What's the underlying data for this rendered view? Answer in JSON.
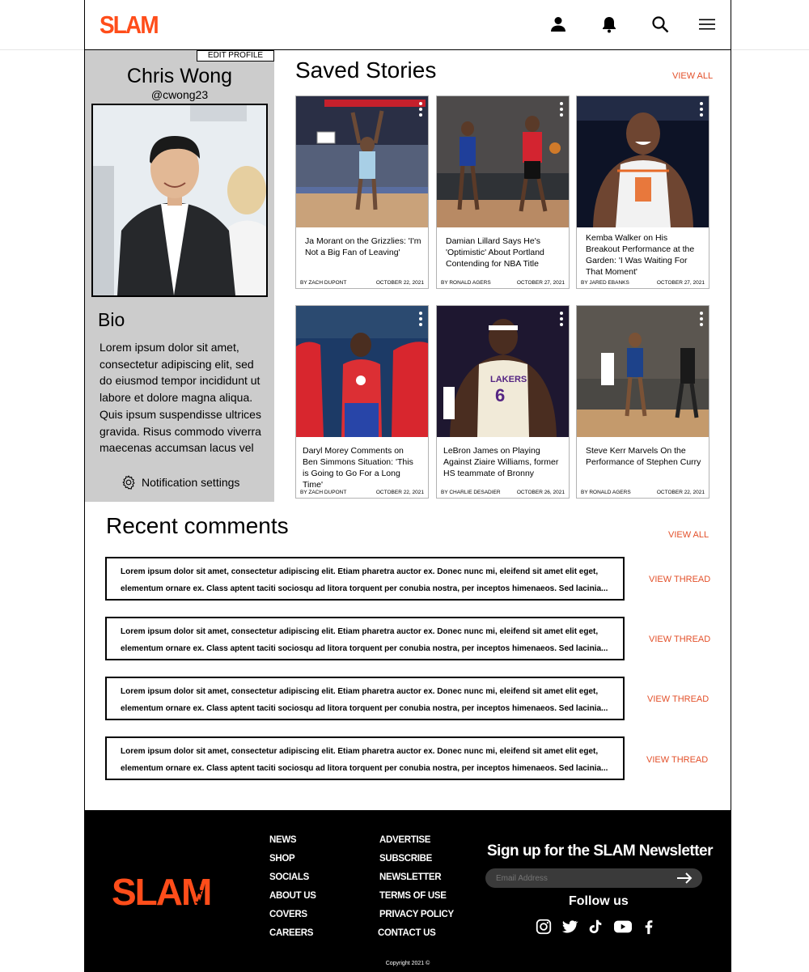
{
  "header": {
    "logo": "SLAM"
  },
  "profile": {
    "edit_label": "EDIT PROFILE",
    "name": "Chris Wong",
    "handle": "@cwong23",
    "bio_heading": "Bio",
    "bio_text": "Lorem ipsum dolor sit amet, consectetur adipiscing elit, sed do eiusmod tempor incididunt ut labore et dolore magna aliqua. Quis ipsum suspendisse ultrices gravida. Risus commodo viverra maecenas accumsan lacus vel",
    "notification_label": "Notification settings"
  },
  "saved": {
    "heading": "Saved Stories",
    "view_all": "VIEW ALL",
    "stories": [
      {
        "title": "Ja Morant on the Grizzlies: 'I'm Not a Big Fan of Leaving'",
        "author": "BY ZACH DUPONT",
        "date": "OCTOBER 22, 2021"
      },
      {
        "title": "Damian Lillard Says He's 'Optimistic' About Portland Contending for NBA Title",
        "author": "BY RONALD AGERS",
        "date": "OCTOBER 27, 2021"
      },
      {
        "title": "Kemba Walker on His Breakout Performance at the Garden: 'I Was Waiting For That Moment'",
        "author": "BY JARED EBANKS",
        "date": "OCTOBER 27, 2021"
      },
      {
        "title": "Daryl Morey Comments on Ben Simmons Situation: 'This is Going to Go For a Long Time'",
        "author": "BY ZACH DUPONT",
        "date": "OCTOBER 22, 2021"
      },
      {
        "title": "LeBron James on Playing Against Ziaire Williams, former HS teammate of Bronny",
        "author": "BY CHARLIE DESADIER",
        "date": "OCTOBER 26, 2021"
      },
      {
        "title": "Steve Kerr Marvels On the Performance of Stephen Curry",
        "author": "BY RONALD AGERS",
        "date": "OCTOBER 22, 2021"
      }
    ]
  },
  "comments": {
    "heading": "Recent comments",
    "view_all": "VIEW ALL",
    "items": [
      {
        "text": "Lorem ipsum dolor sit amet, consectetur adipiscing elit. Etiam pharetra auctor ex. Donec nunc mi, eleifend sit amet elit eget, elementum ornare ex. Class aptent taciti sociosqu ad litora torquent per conubia nostra, per inceptos himenaeos. Sed lacinia...",
        "link": "VIEW THREAD"
      },
      {
        "text": "Lorem ipsum dolor sit amet, consectetur adipiscing elit. Etiam pharetra auctor ex. Donec nunc mi, eleifend sit amet elit eget, elementum ornare ex. Class aptent taciti sociosqu ad litora torquent per conubia nostra, per inceptos himenaeos. Sed lacinia...",
        "link": "VIEW THREAD"
      },
      {
        "text": "Lorem ipsum dolor sit amet, consectetur adipiscing elit. Etiam pharetra auctor ex. Donec nunc mi, eleifend sit amet elit eget, elementum ornare ex. Class aptent taciti sociosqu ad litora torquent per conubia nostra, per inceptos himenaeos. Sed lacinia...",
        "link": "VIEW THREAD"
      },
      {
        "text": "Lorem ipsum dolor sit amet, consectetur adipiscing elit. Etiam pharetra auctor ex. Donec nunc mi, eleifend sit amet elit eget, elementum ornare ex. Class aptent taciti sociosqu ad litora torquent per conubia nostra, per inceptos himenaeos. Sed lacinia...",
        "link": "VIEW THREAD"
      }
    ]
  },
  "footer": {
    "logo": "SLAM",
    "col1": [
      "NEWS",
      "SHOP",
      "SOCIALS",
      "ABOUT US",
      "COVERS",
      "CAREERS"
    ],
    "col2": [
      "ADVERTISE",
      "SUBSCRIBE",
      "NEWSLETTER",
      "TERMS OF USE",
      "PRIVACY POLICY",
      "CONTACT US"
    ],
    "newsletter_heading": "Sign up for the SLAM Newsletter",
    "email_placeholder": "Email Address",
    "follow_label": "Follow us",
    "copyright": "Copyright 2021 ©",
    "icons": [
      "instagram-icon",
      "twitter-icon",
      "tiktok-icon",
      "youtube-icon",
      "facebook-icon"
    ]
  },
  "colors": {
    "accent": "#e3502a",
    "logo": "#ff4d1a",
    "panel": "#cccccc",
    "footer_bg": "#000000"
  }
}
